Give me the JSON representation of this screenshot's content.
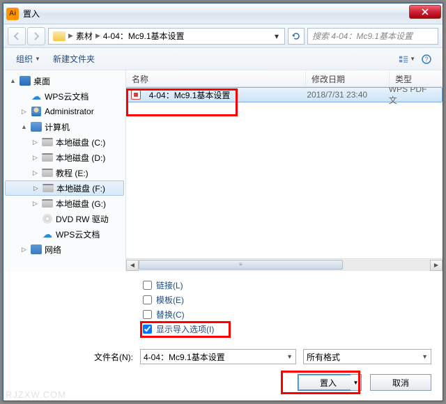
{
  "window": {
    "title": "置入"
  },
  "nav": {
    "path_segments": [
      "素材",
      "4-04：Mc9.1基本设置"
    ],
    "search_placeholder": "搜索 4-04：Mc9.1基本设置"
  },
  "toolbar": {
    "organize": "组织",
    "new_folder": "新建文件夹"
  },
  "sidebar": {
    "items": [
      {
        "label": "桌面",
        "icon": "desktop",
        "indent": 0,
        "expand": "▲"
      },
      {
        "label": "WPS云文档",
        "icon": "cloud",
        "indent": 1,
        "expand": ""
      },
      {
        "label": "Administrator",
        "icon": "user",
        "indent": 1,
        "expand": "▷"
      },
      {
        "label": "计算机",
        "icon": "computer",
        "indent": 1,
        "expand": "▲"
      },
      {
        "label": "本地磁盘 (C:)",
        "icon": "drive",
        "indent": 2,
        "expand": "▷"
      },
      {
        "label": "本地磁盘 (D:)",
        "icon": "drive",
        "indent": 2,
        "expand": "▷"
      },
      {
        "label": "教程 (E:)",
        "icon": "drive",
        "indent": 2,
        "expand": "▷"
      },
      {
        "label": "本地磁盘 (F:)",
        "icon": "drive",
        "indent": 2,
        "expand": "▷",
        "selected": true
      },
      {
        "label": "本地磁盘 (G:)",
        "icon": "drive",
        "indent": 2,
        "expand": "▷"
      },
      {
        "label": "DVD RW 驱动",
        "icon": "dvd",
        "indent": 2,
        "expand": ""
      },
      {
        "label": "WPS云文档",
        "icon": "cloud",
        "indent": 2,
        "expand": ""
      },
      {
        "label": "网络",
        "icon": "network",
        "indent": 1,
        "expand": "▷"
      }
    ]
  },
  "list": {
    "columns": {
      "name": "名称",
      "date": "修改日期",
      "type": "类型"
    },
    "rows": [
      {
        "name": "4-04：Mc9.1基本设置",
        "date": "2018/7/31 23:40",
        "type": "WPS PDF 文",
        "selected": true
      }
    ]
  },
  "options": {
    "link": {
      "label": "链接(L)",
      "checked": false
    },
    "template": {
      "label": "模板(E)",
      "checked": false
    },
    "replace": {
      "label": "替换(C)",
      "checked": false
    },
    "show_import": {
      "label": "显示导入选项(I)",
      "checked": true
    }
  },
  "filename": {
    "label": "文件名(N):",
    "value": "4-04：Mc9.1基本设置",
    "filter": "所有格式"
  },
  "buttons": {
    "place": "置入",
    "cancel": "取消"
  },
  "watermark": "RJZXW.COM"
}
